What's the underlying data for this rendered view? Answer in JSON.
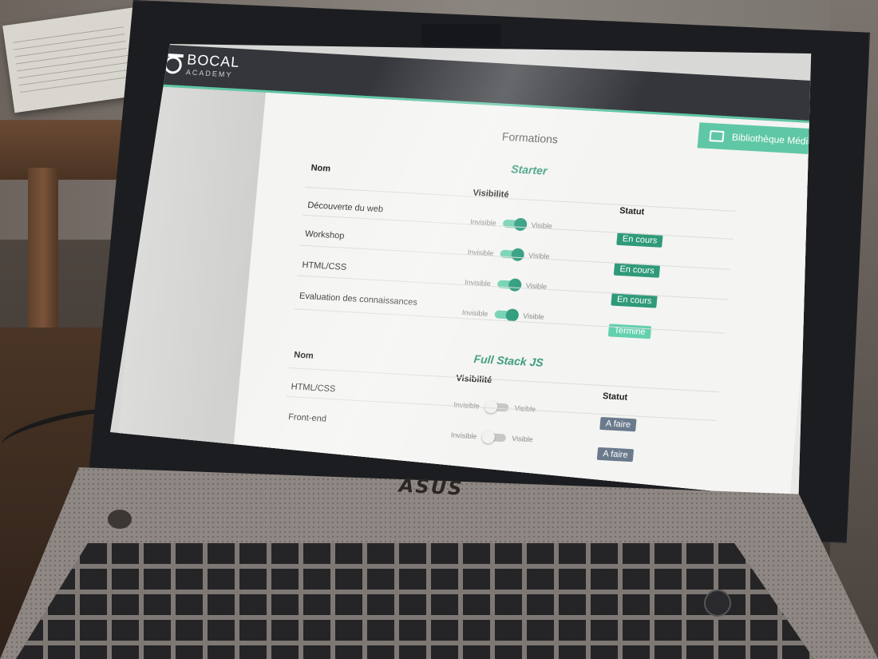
{
  "app": {
    "logo_name": "BOCAL",
    "logo_sub": "ACADEMY"
  },
  "header": {
    "media_button_label": "Bibliothèque Médias"
  },
  "page": {
    "title": "Formations"
  },
  "columns": {
    "name": "Nom",
    "visibility": "Visibilité",
    "status": "Statut"
  },
  "toggle_labels": {
    "off": "Invisible",
    "on": "Visible"
  },
  "sections": [
    {
      "title": "Starter",
      "rows": [
        {
          "name": "Découverte du web",
          "visible": true,
          "status": "En cours",
          "status_kind": "progress"
        },
        {
          "name": "Workshop",
          "visible": true,
          "status": "En cours",
          "status_kind": "progress"
        },
        {
          "name": "HTML/CSS",
          "visible": true,
          "status": "En cours",
          "status_kind": "progress"
        },
        {
          "name": "Evaluation des connaissances",
          "visible": true,
          "status": "Terminé",
          "status_kind": "done"
        }
      ]
    },
    {
      "title": "Full Stack JS",
      "rows": [
        {
          "name": "HTML/CSS",
          "visible": false,
          "status": "A faire",
          "status_kind": "todo"
        },
        {
          "name": "Front-end",
          "visible": false,
          "status": "A faire",
          "status_kind": "todo"
        }
      ]
    }
  ],
  "laptop": {
    "brand": "ASUS"
  },
  "colors": {
    "accent": "#5fc7a5",
    "topbar": "#34363b",
    "status_progress": "#2f9a79",
    "status_done": "#63d0ae",
    "status_todo": "#6a7a8c"
  }
}
